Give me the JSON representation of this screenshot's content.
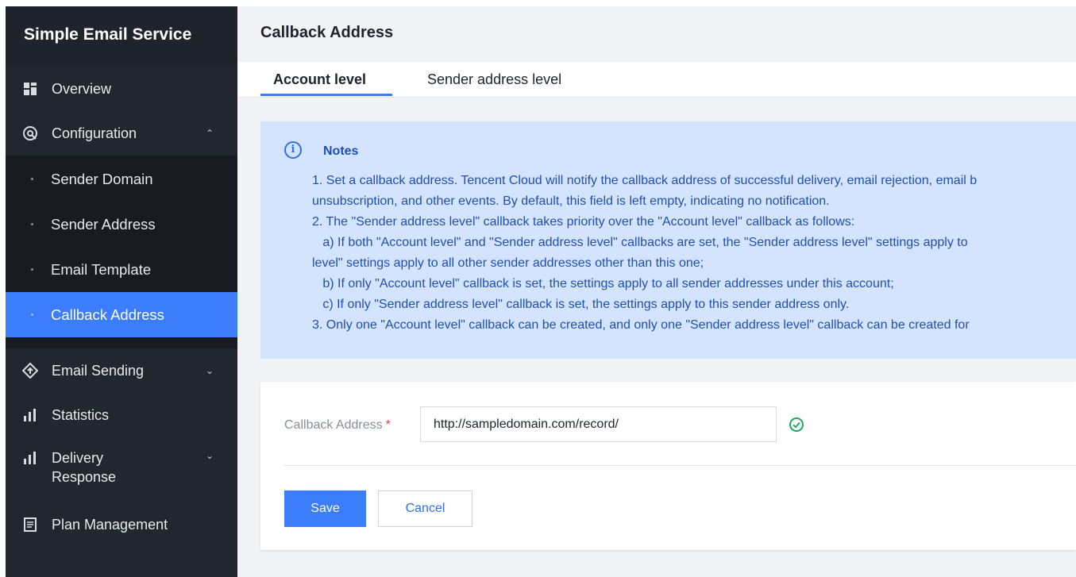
{
  "sidebar": {
    "brand": "Simple Email Service",
    "overview": "Overview",
    "configuration": "Configuration",
    "config_items": [
      "Sender Domain",
      "Sender Address",
      "Email Template",
      "Callback Address"
    ],
    "email_sending": "Email Sending",
    "statistics": "Statistics",
    "delivery_response_line1": "Delivery",
    "delivery_response_line2": "Response",
    "plan_management": "Plan Management"
  },
  "page": {
    "title": "Callback Address",
    "tabs": [
      "Account level",
      "Sender address level"
    ]
  },
  "notes": {
    "title": "Notes",
    "lines": [
      "1. Set a callback address. Tencent Cloud will notify the callback address of successful delivery, email rejection, email b",
      "unsubscription, and other events. By default, this field is left empty, indicating no notification.",
      "2. The \"Sender address level\" callback takes priority over the \"Account level\" callback as follows:",
      "   a) If both \"Account level\" and \"Sender address level\" callbacks are set, the \"Sender address level\" settings apply to",
      "level\" settings apply to all other sender addresses other than this one;",
      "   b) If only \"Account level\" callback is set, the settings apply to all sender addresses under this account;",
      "   c) If only \"Sender address level\" callback is set, the settings apply to this sender address only.",
      "3. Only one \"Account level\" callback can be created, and only one \"Sender address level\" callback can be created for"
    ]
  },
  "form": {
    "label": "Callback Address",
    "required_mark": "*",
    "value": "http://sampledomain.com/record/",
    "save": "Save",
    "cancel": "Cancel"
  },
  "colors": {
    "accent": "#3b7dfb",
    "sidebar_bg": "#22262f",
    "notes_bg": "#d5e4fe",
    "success": "#1ea75a"
  }
}
